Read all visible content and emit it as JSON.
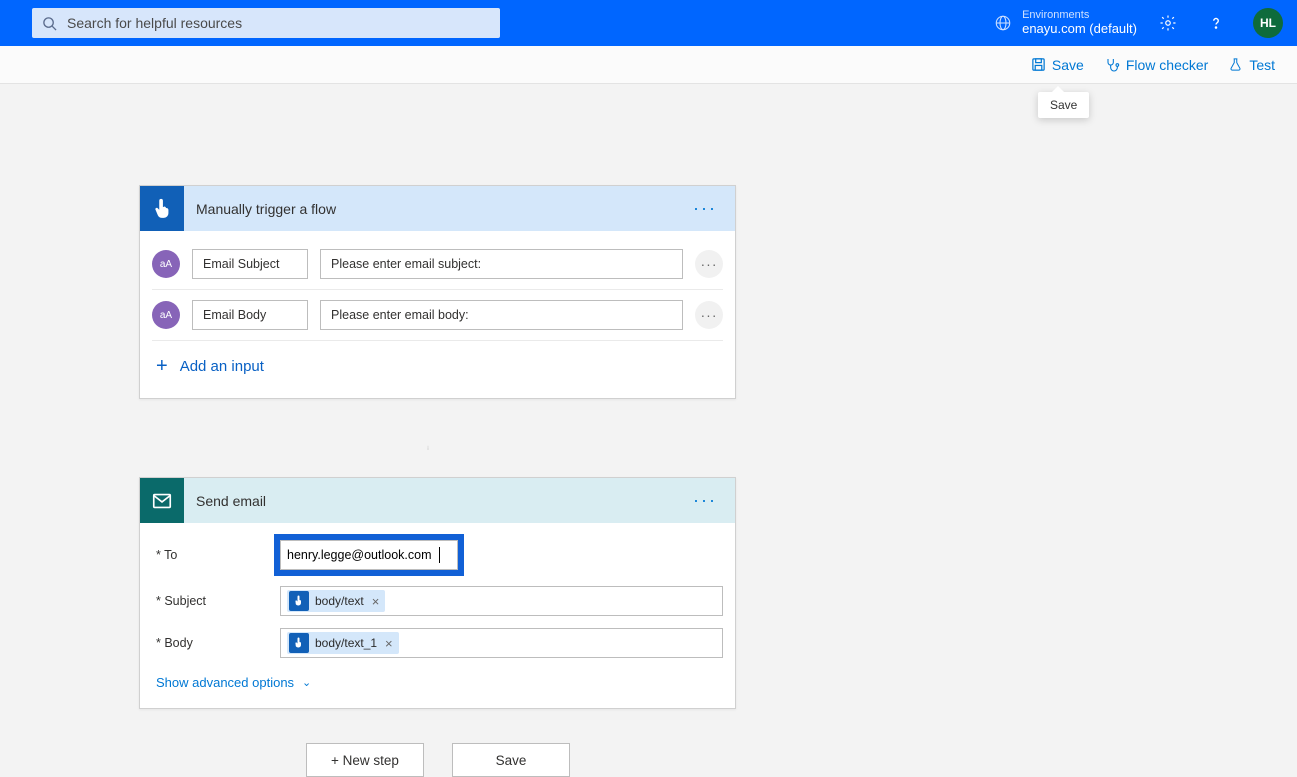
{
  "header": {
    "search_placeholder": "Search for helpful resources",
    "env_label": "Environments",
    "env_name": "enayu.com (default)",
    "avatar_initials": "HL"
  },
  "toolbar": {
    "save": "Save",
    "flow_checker": "Flow checker",
    "test": "Test",
    "tooltip_save": "Save"
  },
  "trigger": {
    "title": "Manually trigger a flow",
    "inputs": [
      {
        "name": "Email Subject",
        "prompt": "Please enter email subject:"
      },
      {
        "name": "Email Body",
        "prompt": "Please enter email body:"
      }
    ],
    "add_input_label": "Add an input"
  },
  "action": {
    "title": "Send email",
    "fields": {
      "to_label": "* To",
      "to_value": "henry.legge@outlook.com",
      "subject_label": "* Subject",
      "subject_token": "body/text",
      "body_label": "* Body",
      "body_token": "body/text_1"
    },
    "advanced": "Show advanced options"
  },
  "bottom": {
    "new_step": "+ New step",
    "save": "Save"
  }
}
